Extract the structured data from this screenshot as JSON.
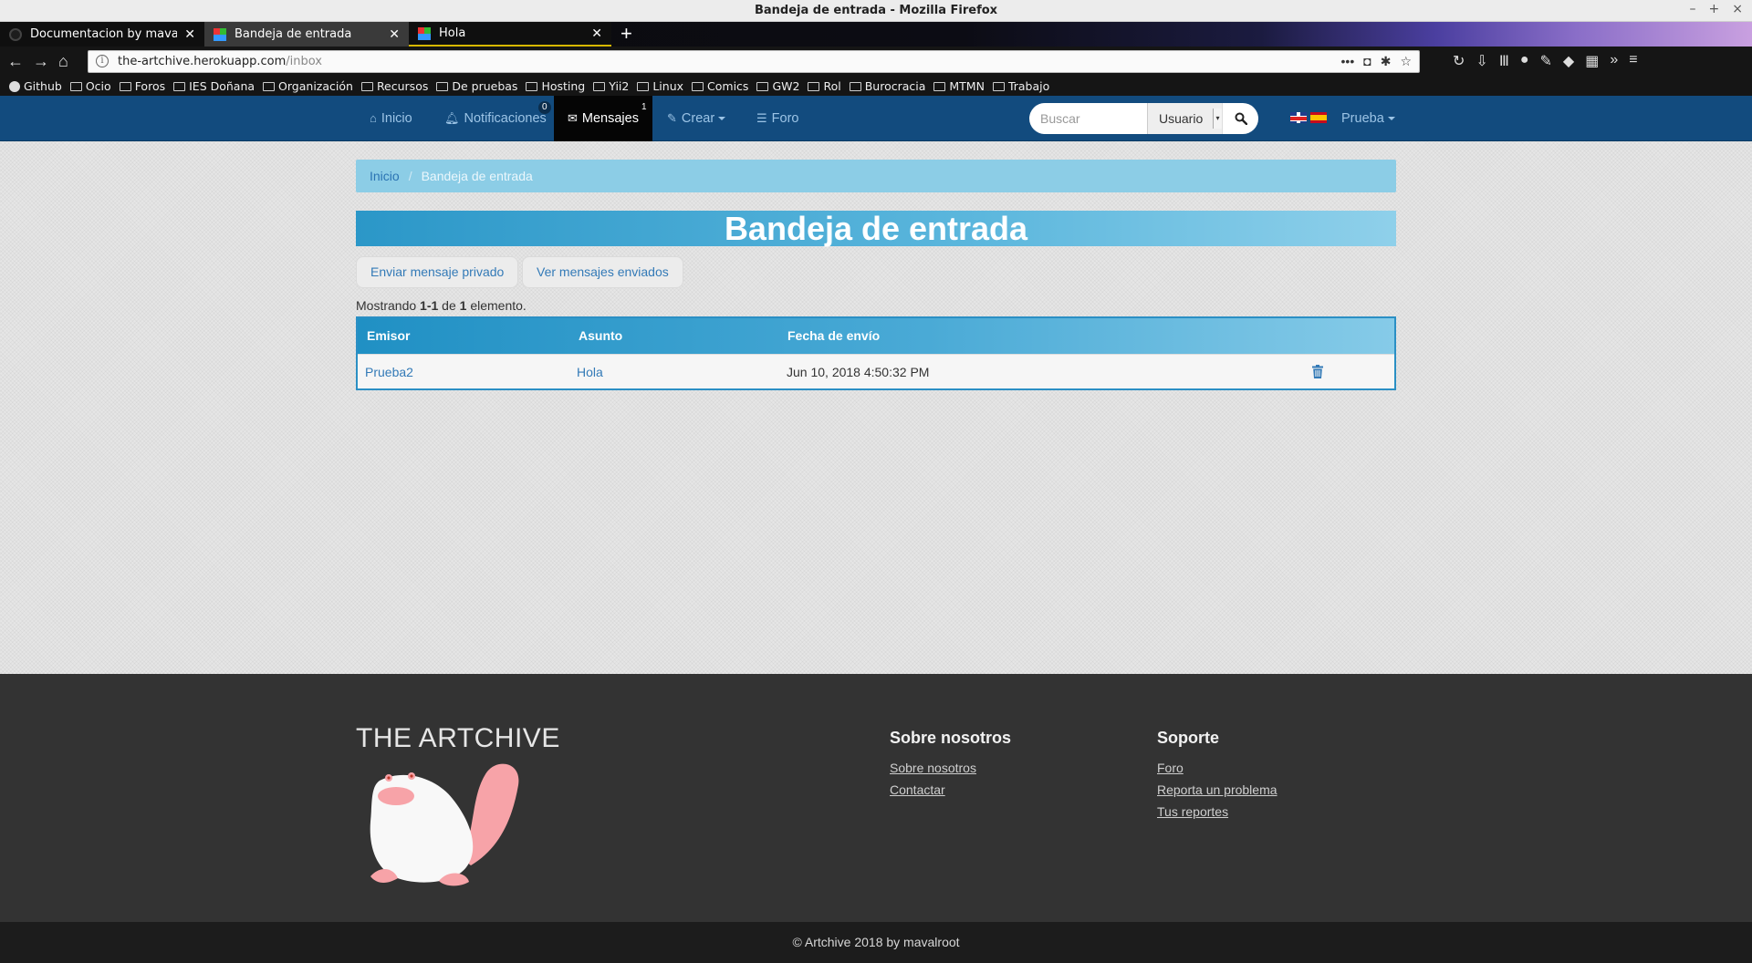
{
  "window": {
    "title": "Bandeja de entrada - Mozilla Firefox",
    "controls": [
      "–",
      "+",
      "×"
    ]
  },
  "tabs": [
    {
      "label": "Documentacion by mavalroot",
      "icon": "github-icon"
    },
    {
      "label": "Bandeja de entrada",
      "icon": "site-favicon"
    },
    {
      "label": "Hola",
      "icon": "site-favicon"
    }
  ],
  "urlbar": {
    "host": "the-artchive.herokuapp.com",
    "path": "/inbox"
  },
  "bookmarks": [
    "Github",
    "Ocio",
    "Foros",
    "IES Doñana",
    "Organización",
    "Recursos",
    "De pruebas",
    "Hosting",
    "Yii2",
    "Linux",
    "Comics",
    "GW2",
    "Rol",
    "Burocracia",
    "MTMN",
    "Trabajo"
  ],
  "nav": {
    "inicio": "Inicio",
    "notificaciones": "Notificaciones",
    "notificaciones_count": "0",
    "mensajes": "Mensajes",
    "mensajes_count": "1",
    "crear": "Crear",
    "foro": "Foro",
    "search_placeholder": "Buscar",
    "search_type": "Usuario",
    "user": "Prueba"
  },
  "breadcrumb": {
    "home": "Inicio",
    "separator": "/",
    "current": "Bandeja de entrada"
  },
  "page": {
    "title": "Bandeja de entrada",
    "send_button": "Enviar mensaje privado",
    "sent_button": "Ver mensajes enviados",
    "summary_prefix": "Mostrando ",
    "summary_range": "1-1",
    "summary_mid": " de ",
    "summary_total": "1",
    "summary_suffix": " elemento."
  },
  "table": {
    "headers": {
      "emisor": "Emisor",
      "asunto": "Asunto",
      "fecha": "Fecha de envío"
    },
    "rows": [
      {
        "emisor": "Prueba2",
        "asunto": "Hola",
        "fecha": "Jun 10, 2018 4:50:32 PM"
      }
    ]
  },
  "footer": {
    "brand": "THE ARTCHIVE",
    "about_heading": "Sobre nosotros",
    "about_links": [
      "Sobre nosotros",
      "Contactar"
    ],
    "support_heading": "Soporte",
    "support_links": [
      "Foro",
      "Reporta un problema",
      "Tus reportes"
    ],
    "copyright": "© Artchive 2018 by mavalroot"
  },
  "colors": {
    "navbar": "#124b7e",
    "active_nav": "#050505",
    "breadcrumb": "#8ccde6",
    "title_gradient_start": "#2b97c8",
    "link": "#337ab7",
    "footer": "#333333",
    "copyright_bar": "#1c1c1c"
  }
}
